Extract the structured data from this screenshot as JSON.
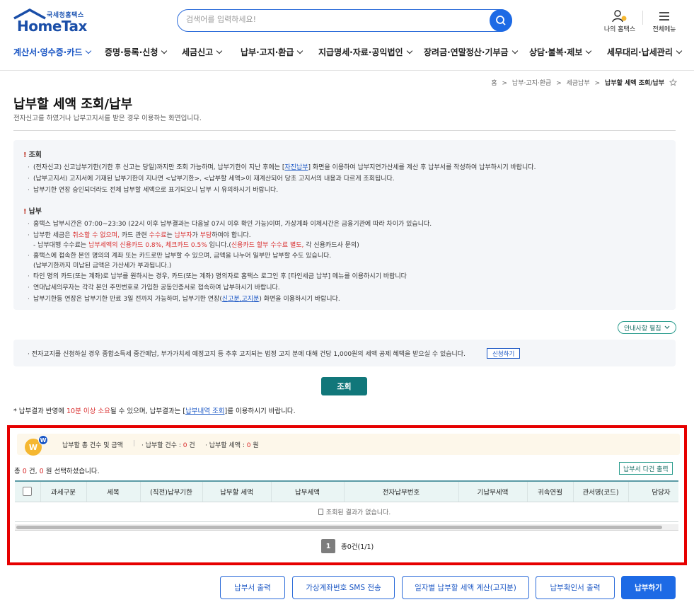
{
  "header": {
    "logo_sub": "국세청홈택스",
    "logo_main": "HomeTax",
    "search_placeholder": "검색어를 입력하세요!",
    "my_hometax": "나의 홈택스",
    "all_menu": "전체메뉴"
  },
  "nav": {
    "items": [
      {
        "label": "계산서·영수증·카드",
        "active": true
      },
      {
        "label": "증명·등록·신청"
      },
      {
        "label": "세금신고"
      },
      {
        "label": "납부·고지·환급"
      },
      {
        "label": "지급명세·자료·공익법인"
      },
      {
        "label": "장려금·연말정산·기부금"
      },
      {
        "label": "상담·불복·제보"
      },
      {
        "label": "세무대리·납세관리"
      }
    ]
  },
  "breadcrumb": {
    "home": "홈",
    "sep": ">",
    "l1": "납부·고지·환급",
    "l2": "세금납부",
    "current": "납부할 세액 조회/납부"
  },
  "page": {
    "title": "납부할 세액 조회/납부",
    "desc": "전자신고를 하였거나 납부고지서를 받은 경우 이용하는 화면입니다."
  },
  "notice": {
    "sec1_title": "조회",
    "sec1": [
      {
        "a": "(전자신고) 신고납부기한(기한 후 신고는 당일)까지만 조회 가능하며, 납부기한이 지난 후에는 [",
        "link": "자진납부",
        "b": "] 화면을 이용하여 납부지연가산세를 계산 후 납부서를 작성하여 납부하시기 바랍니다."
      },
      {
        "a": "(납부고지서) 고지서에 기재된 납부기한이 지나면 <납부기한>, <납부할 세액>이 재계산되어 당초 고지서의 내용과 다르게 조회됩니다."
      },
      {
        "a": "납부기한 연장 승인되더라도 전체 납부할 세액으로 표기되오니 납부 시 유의하시기 바랍니다."
      }
    ],
    "sec2_title": "납부",
    "sec2_l1": "홈택스 납부시간은 07:00~23:30 (22시 이후 납부결과는 다음날 07시 이후 확인 가능)이며, 가상계좌 이체시간은 금융기관에 따라 차이가 있습니다.",
    "sec2_l2_a": "납부한 세금은 ",
    "sec2_l2_r1": "취소할 수 없으며,",
    "sec2_l2_b": " 카드 관련 ",
    "sec2_l2_r2": "수수료",
    "sec2_l2_c": "는 ",
    "sec2_l2_r3": "납부자",
    "sec2_l2_d": "가 ",
    "sec2_l2_r4": "부담",
    "sec2_l2_e": "하여야 합니다.",
    "sec2_l3_a": "- 납부대행 수수료는 ",
    "sec2_l3_r1": "납부세액의 신용카드 0.8%, 체크카드 0.5%",
    "sec2_l3_b": " 입니다.(",
    "sec2_l3_r2": "신용카드 할부 수수료 별도,",
    "sec2_l3_c": " 각 신용카드사 문의)",
    "sec2_l4": "홈택스에 접속한 본인 명의의 계좌 또는 카드로만 납부할 수 있으며, 금액을 나누어 일부만 납부할 수도 있습니다.",
    "sec2_l5": "(납부기한까지 미납된 금액은 가산세가 부과됩니다.)",
    "sec2_l6": "타인 명의 카드(또는 계좌)로 납부를 원하시는 경우, 카드(또는 계좌) 명의자로 홈택스 로그인 후 [타인세금 납부] 메뉴를 이용하시기 바랍니다",
    "sec2_l7": "연대납세의무자는 각각 본인 주민번호로 가입한 공동인증서로 접속하여 납부하시기 바랍니다.",
    "sec2_l8_a": "납부기한등 연장은 납부기한 만료 3일 전까지 가능하며, 납부기한 연장(",
    "sec2_l8_link": "신고분,고지분",
    "sec2_l8_b": ") 화면을 이용하시기 바랍니다."
  },
  "expand_btn": "안내사항 펼침",
  "notice2": {
    "text": "전자고지를 신청하실 경우 종합소득세 중간예납, 부가가치세 예정고지 등 추후 고지되는 법정 고지 분에 대해 건당 1,000원의 세액 공제 혜택을 받으실 수 있습니다.",
    "apply": "신청하기"
  },
  "query_btn": "조회",
  "result_note": {
    "a": "납부결과 반영에 ",
    "red": "10분 이상 소요",
    "b": "될 수 있으며, 납부결과는 [",
    "link": "납부내역 조회",
    "c": "]를 이용하시기 바랍니다."
  },
  "summary": {
    "icon_letter": "W",
    "badge_letter": "W",
    "title": "납부할 총 건수 및 금액",
    "bar": "|",
    "count_label": "· 납부할 건수 : ",
    "count_val": "0",
    "count_unit": " 건",
    "amount_label": "· 납부할 세액 : ",
    "amount_val": "0",
    "amount_unit": " 원"
  },
  "total": {
    "a": "총 ",
    "cnt": "0",
    "b": " 건, ",
    "amt": "0",
    "c": " 원 선택하셨습니다."
  },
  "print_all": "납부서 다건 출력",
  "table": {
    "headers": [
      "과세구분",
      "세목",
      "(직전)납부기한",
      "납부할 세액",
      "납부세액",
      "전자납부번호",
      "기납부세액",
      "귀속연월",
      "관서명(코드)",
      "담당자"
    ],
    "empty": "조회된 결과가 없습니다."
  },
  "pager": {
    "page": "1",
    "info": "총0건(1/1)"
  },
  "buttons": {
    "print": "납부서 출력",
    "sms": "가상계좌번호 SMS 전송",
    "daily": "일자별 납부할 세액 계산(고지분)",
    "confirm": "납부확인서 출력",
    "pay": "납부하기"
  },
  "colors": {
    "brand_blue": "#1d6ae5",
    "teal": "#11777a",
    "highlight_red": "#e60000"
  }
}
